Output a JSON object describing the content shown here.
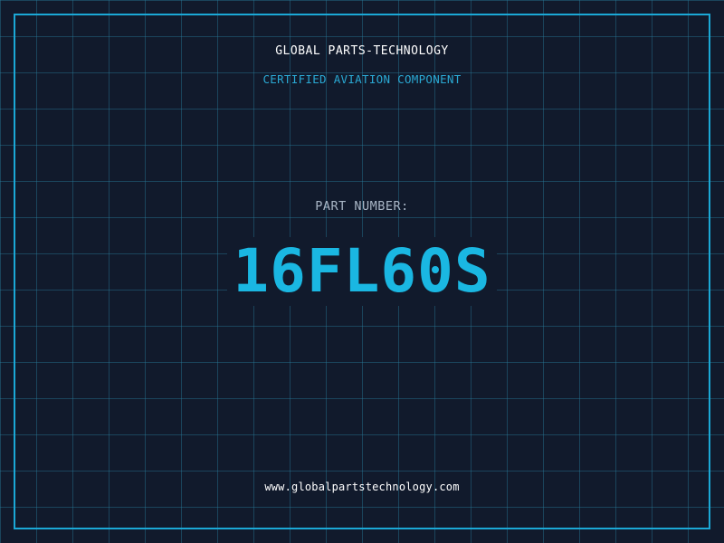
{
  "header": {
    "company_name": "GLOBAL PARTS-TECHNOLOGY",
    "tagline": "CERTIFIED AVIATION COMPONENT"
  },
  "part": {
    "label": "PART NUMBER:",
    "number": "16FL60S"
  },
  "footer": {
    "website": "www.globalpartstechnology.com"
  },
  "colors": {
    "background": "#111a2c",
    "grid": "#28789a",
    "frame": "#1ba8d6",
    "accent": "#1ab7e2",
    "tagline": "#2aa9d4",
    "label": "#a9b6c6",
    "text": "#ffffff"
  }
}
